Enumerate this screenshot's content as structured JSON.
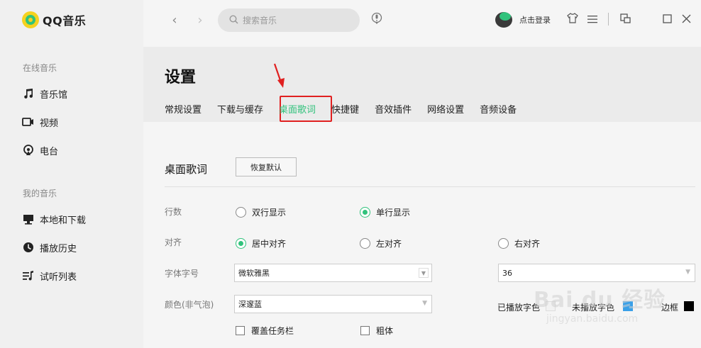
{
  "app": {
    "name": "QQ音乐"
  },
  "sidebar": {
    "online_group": "在线音乐",
    "online_items": [
      {
        "label": "音乐馆",
        "icon": "music-note-icon"
      },
      {
        "label": "视频",
        "icon": "video-icon"
      },
      {
        "label": "电台",
        "icon": "radio-icon"
      }
    ],
    "my_group": "我的音乐",
    "my_items": [
      {
        "label": "本地和下载",
        "icon": "computer-icon"
      },
      {
        "label": "播放历史",
        "icon": "clock-icon"
      },
      {
        "label": "试听列表",
        "icon": "playlist-icon"
      }
    ]
  },
  "topbar": {
    "back": "‹",
    "forward": "›",
    "search_placeholder": "搜索音乐",
    "login": "点击登录"
  },
  "settings": {
    "title": "设置",
    "tabs": [
      "常规设置",
      "下载与缓存",
      "桌面歌词",
      "快捷键",
      "音效插件",
      "网络设置",
      "音频设备"
    ],
    "active_tab": "桌面歌词",
    "section_title": "桌面歌词",
    "restore_button": "恢复默认",
    "rows": {
      "lines_label": "行数",
      "lines_options": [
        "双行显示",
        "单行显示"
      ],
      "lines_selected": "单行显示",
      "align_label": "对齐",
      "align_options": [
        "居中对齐",
        "左对齐",
        "右对齐"
      ],
      "align_selected": "居中对齐",
      "font_label": "字体字号",
      "font_value": "微软雅黑",
      "font_size_value": "36",
      "color_label": "颜色(非气泡)",
      "color_value": "深邃蓝",
      "played_label": "已播放字色",
      "unplayed_label": "未播放字色",
      "border_label": "边框",
      "cover_taskbar": "覆盖任务栏",
      "bold": "粗体"
    },
    "colors": {
      "accent": "#31c27c",
      "played": "#f2f2f2",
      "unplayed": "#3aa0e8",
      "border": "#000000",
      "annotation": "#e02020"
    }
  },
  "watermark": {
    "main": "Bai du 经验",
    "sub": "jingyan.baidu.com"
  }
}
